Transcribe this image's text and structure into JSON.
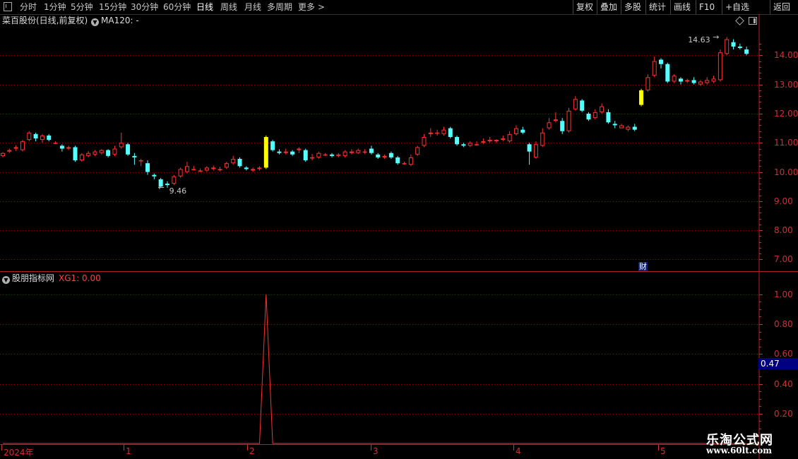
{
  "toolbar": {
    "periods": [
      "分时",
      "1分钟",
      "5分钟",
      "15分钟",
      "30分钟",
      "60分钟",
      "日线",
      "周线",
      "月线",
      "多周期",
      "更多 >"
    ],
    "active_period": "日线",
    "right_buttons": [
      "复权",
      "叠加",
      "多股",
      "统计",
      "画线",
      "F10",
      "+自选",
      "返回"
    ]
  },
  "chart": {
    "title": "菜百股份(日线,前复权)",
    "ma_label": "MA120: -",
    "high_label": "14.63",
    "low_label": "9.46",
    "finance_badge": "财"
  },
  "indicator": {
    "title": "股朋指标网",
    "value_label": "XG1: 0.00",
    "cursor_value": "0.47"
  },
  "price_axis": [
    "14.00",
    "13.00",
    "12.00",
    "11.00",
    "10.00",
    "9.00",
    "8.00",
    "7.00"
  ],
  "indicator_axis": [
    "1.00",
    "0.80",
    "0.60",
    "0.40",
    "0.20"
  ],
  "date_axis": [
    "2024年",
    "1",
    "2",
    "3",
    "4",
    "5"
  ],
  "watermark": {
    "title": "乐淘公式网",
    "url": "www.60lt.com"
  },
  "colors": {
    "up": "#ff3232",
    "down": "#54ffff",
    "signal": "#ffff00",
    "grid": "#8b0000",
    "axis": "#d03030"
  },
  "chart_data": {
    "type": "candlestick",
    "ylim": [
      6.6,
      15.0
    ],
    "candles": [
      [
        10.55,
        10.65,
        10.68,
        10.5
      ],
      [
        10.7,
        10.75,
        10.8,
        10.65
      ],
      [
        10.8,
        10.85,
        10.92,
        10.72
      ],
      [
        10.75,
        11.05,
        11.1,
        10.7
      ],
      [
        11.1,
        11.35,
        11.4,
        11.05
      ],
      [
        11.3,
        11.15,
        11.35,
        11.05
      ],
      [
        11.1,
        11.25,
        11.3,
        11.0
      ],
      [
        11.25,
        11.1,
        11.3,
        11.05
      ],
      [
        11.0,
        11.0,
        11.05,
        10.95
      ],
      [
        10.9,
        10.8,
        10.95,
        10.7
      ],
      [
        10.8,
        10.85,
        10.9,
        10.75
      ],
      [
        10.85,
        10.4,
        10.9,
        10.35
      ],
      [
        10.4,
        10.6,
        10.65,
        10.35
      ],
      [
        10.55,
        10.65,
        10.72,
        10.5
      ],
      [
        10.6,
        10.7,
        10.75,
        10.55
      ],
      [
        10.65,
        10.75,
        10.78,
        10.6
      ],
      [
        10.75,
        10.55,
        10.78,
        10.5
      ],
      [
        10.6,
        10.8,
        10.9,
        10.55
      ],
      [
        10.85,
        11.0,
        11.35,
        10.8
      ],
      [
        10.95,
        10.6,
        11.0,
        10.55
      ],
      [
        10.55,
        10.5,
        10.65,
        10.25
      ],
      [
        10.4,
        10.4,
        10.45,
        10.2
      ],
      [
        10.3,
        10.0,
        10.4,
        9.9
      ],
      [
        9.9,
        9.85,
        9.95,
        9.75
      ],
      [
        9.75,
        9.5,
        9.8,
        9.46
      ],
      [
        9.6,
        9.55,
        9.68,
        9.46
      ],
      [
        9.6,
        9.85,
        9.9,
        9.55
      ],
      [
        9.85,
        10.1,
        10.15,
        9.8
      ],
      [
        10.0,
        10.2,
        10.35,
        9.95
      ],
      [
        10.1,
        10.1,
        10.2,
        10.05
      ],
      [
        10.05,
        10.05,
        10.12,
        10.0
      ],
      [
        10.05,
        10.15,
        10.2,
        10.0
      ],
      [
        10.1,
        10.15,
        10.22,
        10.05
      ],
      [
        10.1,
        10.1,
        10.18,
        10.02
      ],
      [
        10.15,
        10.3,
        10.35,
        10.1
      ],
      [
        10.3,
        10.45,
        10.55,
        10.25
      ],
      [
        10.45,
        10.2,
        10.5,
        10.15
      ],
      [
        10.15,
        10.1,
        10.2,
        10.05
      ],
      [
        10.05,
        10.1,
        10.15,
        10.0
      ],
      [
        10.1,
        10.15,
        10.2,
        10.05
      ],
      [
        10.15,
        11.2,
        11.25,
        10.1
      ],
      [
        11.05,
        10.75,
        11.1,
        10.7
      ],
      [
        10.7,
        10.65,
        10.78,
        10.6
      ],
      [
        10.65,
        10.7,
        10.8,
        10.6
      ],
      [
        10.7,
        10.6,
        10.75,
        10.55
      ],
      [
        10.75,
        10.8,
        10.85,
        10.65
      ],
      [
        10.75,
        10.4,
        10.8,
        10.35
      ],
      [
        10.5,
        10.5,
        10.62,
        10.4
      ],
      [
        10.5,
        10.65,
        10.7,
        10.45
      ],
      [
        10.6,
        10.6,
        10.65,
        10.55
      ],
      [
        10.6,
        10.55,
        10.65,
        10.5
      ],
      [
        10.55,
        10.6,
        10.65,
        10.5
      ],
      [
        10.55,
        10.7,
        10.75,
        10.5
      ],
      [
        10.65,
        10.7,
        10.78,
        10.6
      ],
      [
        10.65,
        10.75,
        10.8,
        10.62
      ],
      [
        10.7,
        10.7,
        10.78,
        10.62
      ],
      [
        10.8,
        10.65,
        10.9,
        10.6
      ],
      [
        10.6,
        10.5,
        10.65,
        10.45
      ],
      [
        10.5,
        10.55,
        10.6,
        10.45
      ],
      [
        10.65,
        10.5,
        10.7,
        10.45
      ],
      [
        10.5,
        10.3,
        10.55,
        10.25
      ],
      [
        10.3,
        10.3,
        10.35,
        10.25
      ],
      [
        10.25,
        10.5,
        10.6,
        10.2
      ],
      [
        10.6,
        10.85,
        10.9,
        10.55
      ],
      [
        10.9,
        11.2,
        11.3,
        10.85
      ],
      [
        11.3,
        11.35,
        11.5,
        11.2
      ],
      [
        11.35,
        11.35,
        11.45,
        11.25
      ],
      [
        11.3,
        11.45,
        11.55,
        11.25
      ],
      [
        11.5,
        11.2,
        11.55,
        11.15
      ],
      [
        11.2,
        10.95,
        11.25,
        10.9
      ],
      [
        10.95,
        10.9,
        11.0,
        10.85
      ],
      [
        10.9,
        11.0,
        11.05,
        10.85
      ],
      [
        10.95,
        10.95,
        11.05,
        10.9
      ],
      [
        11.0,
        11.05,
        11.15,
        10.95
      ],
      [
        11.05,
        11.1,
        11.2,
        11.0
      ],
      [
        11.05,
        11.1,
        11.12,
        11.0
      ],
      [
        11.1,
        11.15,
        11.25,
        11.05
      ],
      [
        11.05,
        11.3,
        11.4,
        11.0
      ],
      [
        11.3,
        11.5,
        11.6,
        11.25
      ],
      [
        11.45,
        11.35,
        11.55,
        11.3
      ],
      [
        10.95,
        10.7,
        11.0,
        10.25
      ],
      [
        10.5,
        10.95,
        11.05,
        10.45
      ],
      [
        10.9,
        11.35,
        11.5,
        10.85
      ],
      [
        11.5,
        11.7,
        11.85,
        11.45
      ],
      [
        11.75,
        11.8,
        12.05,
        11.7
      ],
      [
        11.75,
        11.4,
        11.85,
        11.3
      ],
      [
        11.4,
        12.1,
        12.2,
        11.35
      ],
      [
        12.15,
        12.5,
        12.6,
        12.1
      ],
      [
        12.45,
        12.1,
        12.5,
        12.05
      ],
      [
        12.0,
        11.8,
        12.05,
        11.75
      ],
      [
        11.85,
        12.05,
        12.15,
        11.8
      ],
      [
        12.05,
        12.25,
        12.35,
        12.0
      ],
      [
        12.05,
        11.7,
        12.15,
        11.65
      ],
      [
        11.65,
        11.6,
        11.75,
        11.5
      ],
      [
        11.5,
        11.6,
        11.65,
        11.5
      ],
      [
        11.45,
        11.55,
        11.6,
        11.4
      ],
      [
        11.55,
        11.45,
        11.65,
        11.4
      ],
      [
        12.3,
        12.8,
        12.85,
        12.25
      ],
      [
        12.8,
        13.25,
        13.35,
        12.75
      ],
      [
        13.3,
        13.8,
        13.95,
        13.25
      ],
      [
        13.85,
        13.7,
        13.9,
        13.55
      ],
      [
        13.7,
        13.1,
        13.75,
        13.05
      ],
      [
        13.1,
        13.3,
        13.35,
        13.05
      ],
      [
        13.2,
        13.1,
        13.25,
        13.0
      ],
      [
        13.1,
        13.15,
        13.2,
        13.05
      ],
      [
        13.15,
        13.05,
        13.25,
        13.0
      ],
      [
        13.0,
        13.1,
        13.15,
        12.95
      ],
      [
        13.05,
        13.15,
        13.25,
        13.0
      ],
      [
        13.1,
        13.2,
        13.3,
        13.05
      ],
      [
        13.15,
        14.1,
        14.2,
        13.1
      ],
      [
        14.05,
        14.55,
        14.63,
        14.0
      ],
      [
        14.45,
        14.3,
        14.55,
        14.2
      ],
      [
        14.3,
        14.25,
        14.4,
        14.2
      ],
      [
        14.2,
        14.05,
        14.3,
        14.0
      ]
    ],
    "signal_candle_indices": [
      40,
      97
    ],
    "indicator": {
      "name": "XG1",
      "spike_index": 40,
      "spike_value": 1.0,
      "ylim": [
        0,
        1.07
      ]
    }
  }
}
